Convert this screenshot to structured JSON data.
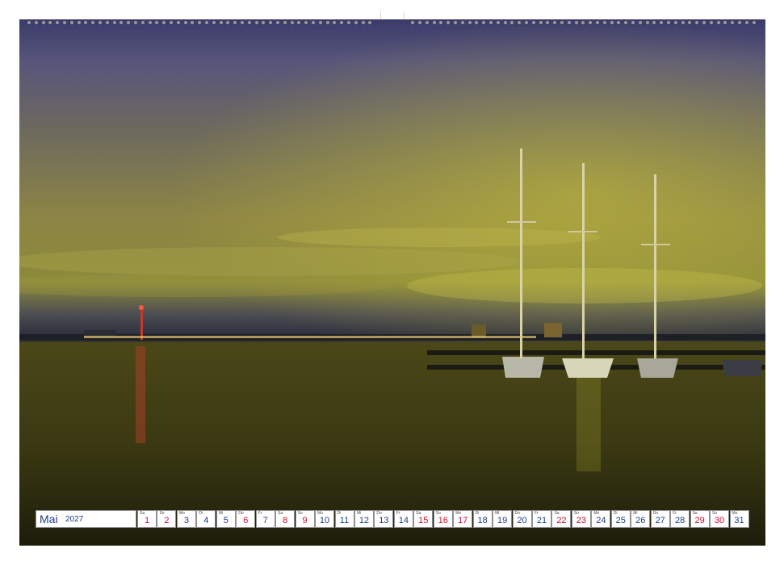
{
  "calendar": {
    "month": "Mai",
    "year": "2027",
    "days": [
      {
        "wd": "Sa",
        "n": "1",
        "red": true
      },
      {
        "wd": "So",
        "n": "2",
        "red": true
      },
      {
        "wd": "Mo",
        "n": "3",
        "red": false
      },
      {
        "wd": "Di",
        "n": "4",
        "red": false
      },
      {
        "wd": "Mi",
        "n": "5",
        "red": false
      },
      {
        "wd": "Do",
        "n": "6",
        "red": true
      },
      {
        "wd": "Fr",
        "n": "7",
        "red": false
      },
      {
        "wd": "Sa",
        "n": "8",
        "red": true
      },
      {
        "wd": "So",
        "n": "9",
        "red": true
      },
      {
        "wd": "Mo",
        "n": "10",
        "red": false
      },
      {
        "wd": "Di",
        "n": "11",
        "red": false
      },
      {
        "wd": "Mi",
        "n": "12",
        "red": false
      },
      {
        "wd": "Do",
        "n": "13",
        "red": false
      },
      {
        "wd": "Fr",
        "n": "14",
        "red": false
      },
      {
        "wd": "Sa",
        "n": "15",
        "red": true
      },
      {
        "wd": "So",
        "n": "16",
        "red": true
      },
      {
        "wd": "Mo",
        "n": "17",
        "red": true
      },
      {
        "wd": "Di",
        "n": "18",
        "red": false
      },
      {
        "wd": "Mi",
        "n": "19",
        "red": false
      },
      {
        "wd": "Do",
        "n": "20",
        "red": false
      },
      {
        "wd": "Fr",
        "n": "21",
        "red": false
      },
      {
        "wd": "Sa",
        "n": "22",
        "red": true
      },
      {
        "wd": "So",
        "n": "23",
        "red": true
      },
      {
        "wd": "Mo",
        "n": "24",
        "red": false
      },
      {
        "wd": "Di",
        "n": "25",
        "red": false
      },
      {
        "wd": "Mi",
        "n": "26",
        "red": false
      },
      {
        "wd": "Do",
        "n": "27",
        "red": false
      },
      {
        "wd": "Fr",
        "n": "28",
        "red": false
      },
      {
        "wd": "Sa",
        "n": "29",
        "red": true
      },
      {
        "wd": "So",
        "n": "30",
        "red": true
      },
      {
        "wd": "Mo",
        "n": "31",
        "red": false
      }
    ]
  },
  "colors": {
    "accent": "#1f3a8a",
    "holiday": "#c8102e"
  }
}
